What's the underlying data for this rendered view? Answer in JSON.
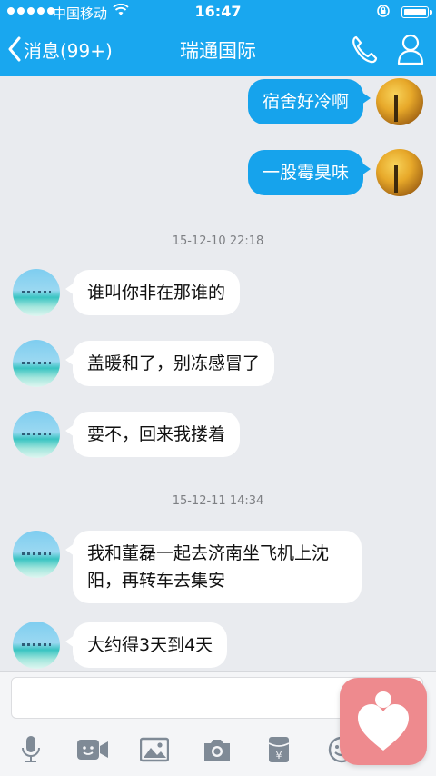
{
  "status_bar": {
    "carrier": "中国移动",
    "time": "16:47"
  },
  "nav": {
    "back_label": "消息(99+)",
    "title": "瑞通国际"
  },
  "messages": [
    {
      "from": "me",
      "text": "宿舍好冷啊"
    },
    {
      "from": "me",
      "text": "一股霉臭味"
    },
    {
      "type": "time",
      "text": "15-12-10 22:18"
    },
    {
      "from": "friend",
      "text": "谁叫你非在那谁的"
    },
    {
      "from": "friend",
      "text": "盖暖和了，别冻感冒了"
    },
    {
      "from": "friend",
      "text": "要不，回来我搂着"
    },
    {
      "type": "time",
      "text": "15-12-11 14:34"
    },
    {
      "from": "friend",
      "text": "我和董磊一起去济南坐飞机上沈阳，再转车去集安"
    },
    {
      "from": "friend",
      "text": "大约得3天到4天"
    }
  ],
  "input": {
    "placeholder": ""
  },
  "toolbar_icons": [
    "microphone-icon",
    "video-icon",
    "image-icon",
    "camera-icon",
    "red-packet-icon",
    "emoji-icon"
  ],
  "colors": {
    "brand_blue": "#19a7ef",
    "bubble_out": "#16a3ec",
    "background": "#e9ebef"
  }
}
